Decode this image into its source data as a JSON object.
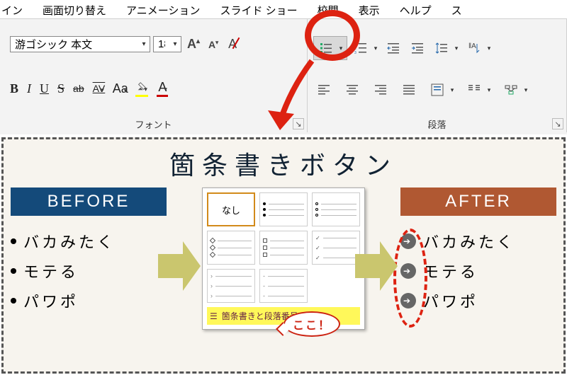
{
  "tabs": [
    "イン",
    "画面切り替え",
    "アニメーション",
    "スライド ショー",
    "校閲",
    "表示",
    "ヘルプ",
    "ス"
  ],
  "font": {
    "name": "游ゴシック 本文",
    "size": "18",
    "group_label": "フォント"
  },
  "para": {
    "group_label": "段落"
  },
  "panel": {
    "title": "箇条書きボタン",
    "before_label": "BEFORE",
    "after_label": "AFTER",
    "items": [
      "バカみたく",
      "モテる",
      "パワポ"
    ],
    "dropdown_none": "なし",
    "dropdown_footer": "箇条書きと段落番号(N)...",
    "koko": "ここ！"
  }
}
